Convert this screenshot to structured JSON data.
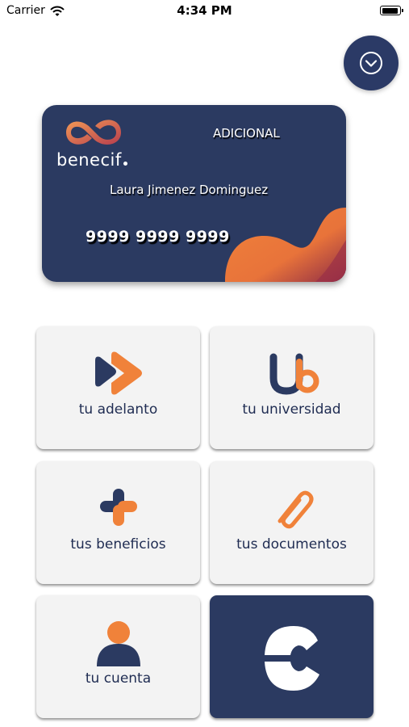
{
  "status_bar": {
    "carrier": "Carrier",
    "time": "4:34 PM",
    "wifi_icon": "wifi-icon",
    "battery_icon": "battery-icon"
  },
  "header": {
    "dropdown_icon": "chevron-down-circle-icon"
  },
  "card": {
    "brand": "benecif",
    "type": "ADICIONAL",
    "holder_name": "Laura Jimenez Dominguez",
    "number": "9999 9999 9999",
    "colors": {
      "background": "#2b3a61",
      "accent": "#f0823a"
    }
  },
  "menu": {
    "items": [
      {
        "label": "tu adelanto",
        "icon": "double-arrow-icon"
      },
      {
        "label": "tu universidad",
        "icon": "ub-logo-icon"
      },
      {
        "label": "tus beneficios",
        "icon": "plus-icon"
      },
      {
        "label": "tus documentos",
        "icon": "paperclip-icon"
      },
      {
        "label": "tu cuenta",
        "icon": "user-icon"
      },
      {
        "label": "",
        "icon": "c-logo-icon"
      }
    ]
  },
  "colors": {
    "navy": "#2b3a61",
    "orange": "#f0823a",
    "tile_background": "#f3f3f3"
  }
}
